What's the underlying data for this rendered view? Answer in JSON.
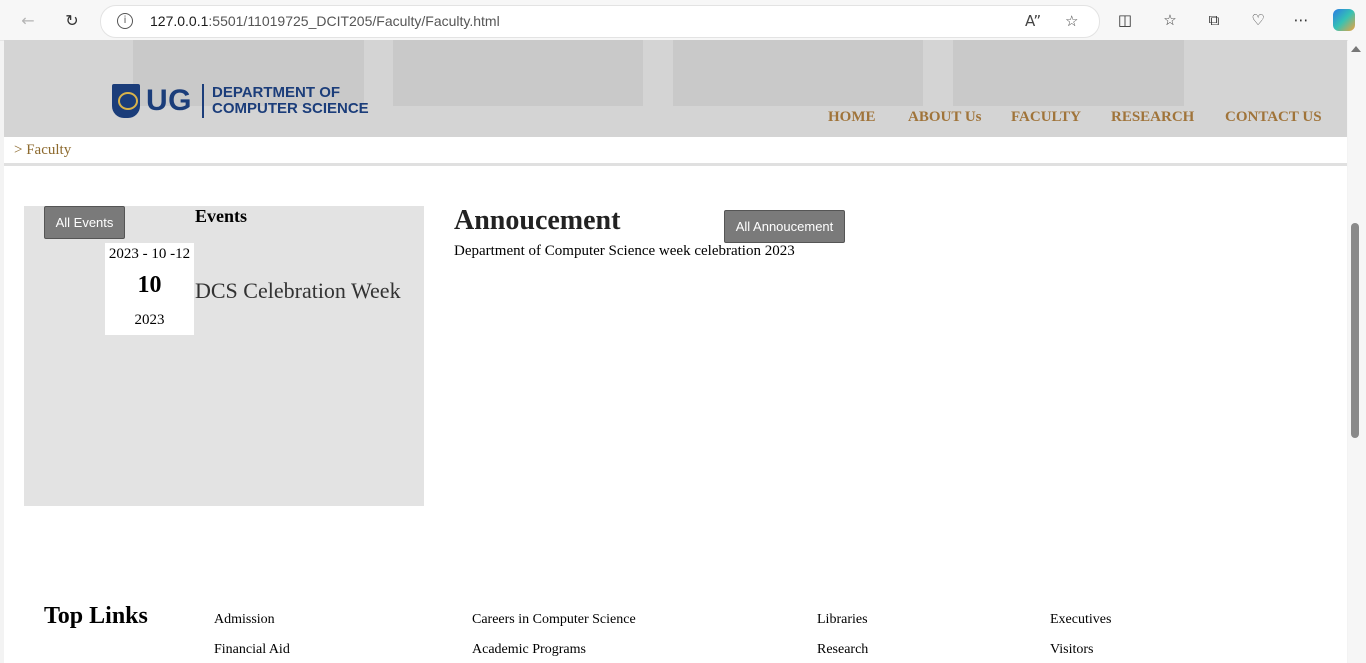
{
  "browser": {
    "url_host": "127.0.0.1",
    "url_path": ":5501/11019725_DCIT205/Faculty/Faculty.html"
  },
  "header": {
    "logo_ug": "UG",
    "logo_dept_line1": "DEPARTMENT OF",
    "logo_dept_line2": "COMPUTER SCIENCE",
    "nav": [
      "HOME",
      "ABOUT Us",
      "FACULTY",
      "RESEARCH",
      "CONTACT US"
    ]
  },
  "breadcrumb": "> Faculty",
  "events": {
    "button_label": "All Events",
    "title": "Events",
    "items": [
      {
        "date_full": "2023 - 10 -12",
        "day": "10",
        "year": "2023",
        "name": "DCS Celebration Week"
      }
    ]
  },
  "announcement": {
    "title": "Annoucement",
    "button_label": "All Annoucement",
    "text": "Department of Computer Science week celebration 2023"
  },
  "footer": {
    "top_links_title": "Top Links",
    "links": [
      "Admission",
      "Careers in Computer Science",
      "Libraries",
      "Executives",
      "Financial Aid",
      "Academic Programs",
      "Research",
      "Visitors"
    ]
  }
}
